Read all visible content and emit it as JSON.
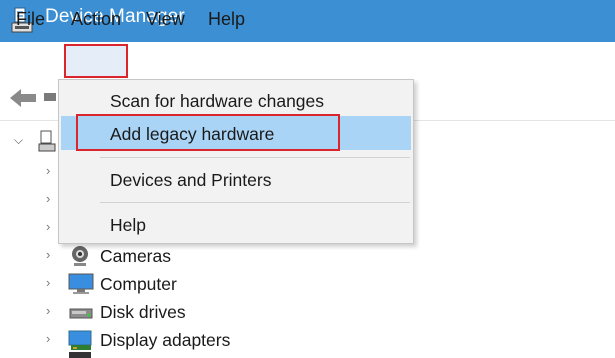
{
  "window": {
    "title": "Device Manager"
  },
  "menubar": {
    "file": "File",
    "action": "Action",
    "view": "View",
    "help": "Help"
  },
  "action_menu": {
    "items": [
      {
        "label": "Scan for hardware changes",
        "highlighted": false
      },
      {
        "label": "Add legacy hardware",
        "highlighted": true
      },
      {
        "label": "Devices and Printers",
        "highlighted": false
      },
      {
        "label": "Help",
        "highlighted": false
      }
    ]
  },
  "tree": {
    "items": [
      {
        "label": "Cameras",
        "icon": "camera-icon"
      },
      {
        "label": "Computer",
        "icon": "computer-icon"
      },
      {
        "label": "Disk drives",
        "icon": "disk-drive-icon"
      },
      {
        "label": "Display adapters",
        "icon": "display-adapter-icon"
      }
    ]
  },
  "colors": {
    "titlebar": "#3b8fd2",
    "highlight_border": "#d9252b",
    "menu_hover": "#a9d4f5"
  }
}
